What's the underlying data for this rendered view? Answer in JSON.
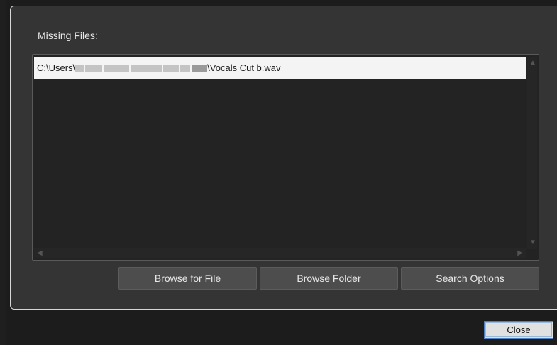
{
  "dialog": {
    "missing_files_label": "Missing Files:",
    "files": [
      {
        "path_prefix": "C:\\Users\\",
        "path_suffix": "\\Vocals Cut b.wav"
      }
    ],
    "buttons": {
      "browse_file": "Browse for File",
      "browse_folder": "Browse Folder",
      "search_options": "Search Options"
    },
    "close_label": "Close"
  },
  "colors": {
    "panel_bg": "#343434",
    "list_bg": "#232323",
    "selected_row": "#f4f4f4",
    "button_bg": "#4d4d4d",
    "close_border": "#4f7fbf"
  },
  "icons": {
    "scroll_up": "▲",
    "scroll_down": "▼",
    "scroll_left": "◀",
    "scroll_right": "▶"
  }
}
